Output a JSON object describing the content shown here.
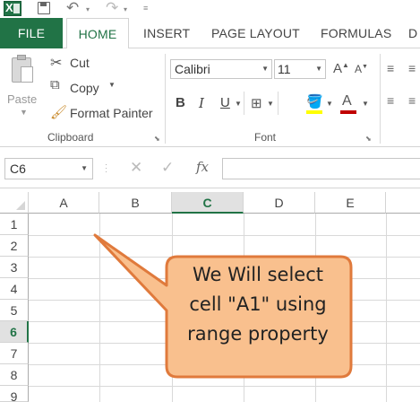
{
  "quick_access": {
    "icons": [
      "excel-logo-icon",
      "save-icon",
      "undo-icon",
      "redo-icon"
    ]
  },
  "tabs": {
    "file": "FILE",
    "home": "HOME",
    "insert": "INSERT",
    "page_layout": "PAGE LAYOUT",
    "formulas": "FORMULAS",
    "data_partial": "D"
  },
  "clipboard": {
    "paste": "Paste",
    "cut": "Cut",
    "copy": "Copy",
    "format_painter": "Format Painter",
    "group_label": "Clipboard"
  },
  "font": {
    "font_name": "Calibri",
    "font_size": "11",
    "bold": "B",
    "italic": "I",
    "underline": "U",
    "group_label": "Font",
    "grow": "A",
    "shrink": "A",
    "font_color_glyph": "A",
    "colors": {
      "fill": "#ffff00",
      "font": "#c00000"
    }
  },
  "formula_bar": {
    "name_box": "C6",
    "fx": "fx",
    "value": ""
  },
  "sheet": {
    "columns": [
      "A",
      "B",
      "C",
      "D",
      "E"
    ],
    "rows": [
      "1",
      "2",
      "3",
      "4",
      "5",
      "6",
      "7",
      "8",
      "9"
    ],
    "selected_column": "C",
    "selected_row": "6"
  },
  "callout": {
    "lines": [
      "We Will select",
      "cell \"A1\" using",
      "range property"
    ],
    "fill": "#f9c08e",
    "stroke": "#e07a3c"
  },
  "colors": {
    "accent": "#217346"
  }
}
